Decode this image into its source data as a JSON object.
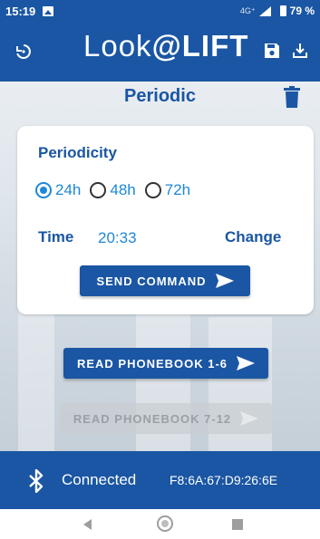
{
  "status_bar": {
    "time": "15:19",
    "network": "4G⁺",
    "battery_percent": "79 %"
  },
  "app_bar": {
    "logo_part1": "Look",
    "logo_part2": "@",
    "logo_part3": "LIFT",
    "brand_color": "#1a56a3"
  },
  "page": {
    "title": "Periodic"
  },
  "periodicity": {
    "label": "Periodicity",
    "options": [
      "24h",
      "48h",
      "72h"
    ],
    "selected": "24h"
  },
  "time": {
    "label": "Time",
    "value": "20:33",
    "change_label": "Change"
  },
  "buttons": {
    "send_command": "SEND COMMAND",
    "read_phonebook_1_6": "READ PHONEBOOK 1-6",
    "read_phonebook_7_12": "READ PHONEBOOK 7-12"
  },
  "footer": {
    "status": "Connected",
    "mac": "F8:6A:67:D9:26:6E",
    "icon": "bluetooth-icon"
  },
  "colors": {
    "primary": "#1a56a3",
    "accent": "#1e88d8",
    "disabled": "#c8cdd2"
  }
}
